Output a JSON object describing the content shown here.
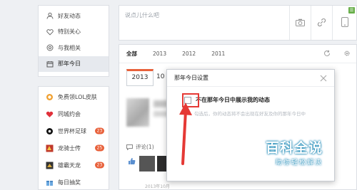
{
  "sidebar": {
    "top_items": [
      {
        "label": "好友动态",
        "icon": "user-icon"
      },
      {
        "label": "特别关心",
        "icon": "heart-outline-icon"
      },
      {
        "label": "与我相关",
        "icon": "at-icon"
      },
      {
        "label": "那年今日",
        "icon": "calendar-icon"
      }
    ],
    "bottom_items": [
      {
        "label": "免费领LOL皮肤",
        "icon": "lol-icon",
        "badge": ""
      },
      {
        "label": "同城约会",
        "icon": "heart-filled-icon",
        "badge": ""
      },
      {
        "label": "世界杯足球",
        "icon": "football-icon",
        "badge": "23"
      },
      {
        "label": "龙骑士传",
        "icon": "dragon-icon",
        "badge": "25"
      },
      {
        "label": "雄霸天龙",
        "icon": "game-icon",
        "badge": "23"
      },
      {
        "label": "每日抽奖",
        "icon": "gift-icon",
        "badge": ""
      }
    ]
  },
  "composer": {
    "placeholder": "说点儿什么吧"
  },
  "feed": {
    "tabs": [
      "全部",
      "2013",
      "2012",
      "2011"
    ],
    "date_year": "2013",
    "date_day": "10",
    "comment_label": "评论(1)",
    "time_text": "2013年10月"
  },
  "dialog": {
    "title": "那年今日设置",
    "checkbox_label": "不在那年今日中展示我的动态",
    "hint": "勾选后，你的动态将不会出现在好友及你的那年今日中"
  },
  "watermark": {
    "title": "百科全说",
    "subtitle": "助你轻松解决"
  },
  "colors": {
    "accent": "#e8613b",
    "highlight": "#e53935",
    "badge_green": "#6ab04c"
  }
}
